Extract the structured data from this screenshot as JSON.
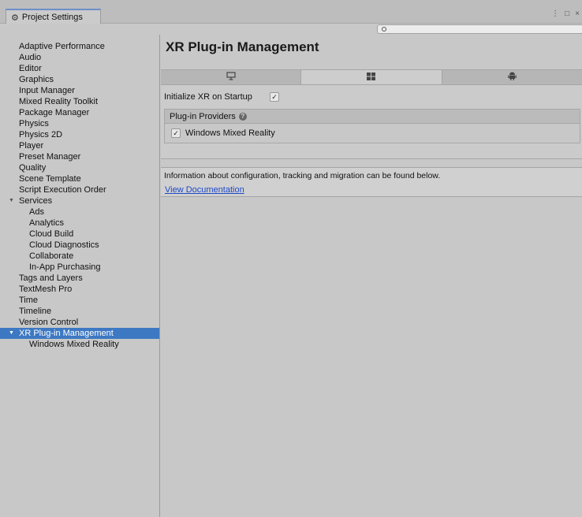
{
  "window": {
    "tab_icon": "gear-icon",
    "tab_icon_glyph": "⚙",
    "tab_title": "Project Settings",
    "controls": [
      "⋮",
      "□",
      "×"
    ]
  },
  "search": {
    "placeholder": "",
    "icon": "search-icon",
    "icon_glyph": "🔍"
  },
  "sidebar": {
    "items": [
      {
        "label": "Adaptive Performance",
        "level": 0
      },
      {
        "label": "Audio",
        "level": 0
      },
      {
        "label": "Editor",
        "level": 0
      },
      {
        "label": "Graphics",
        "level": 0
      },
      {
        "label": "Input Manager",
        "level": 0
      },
      {
        "label": "Mixed Reality Toolkit",
        "level": 0
      },
      {
        "label": "Package Manager",
        "level": 0
      },
      {
        "label": "Physics",
        "level": 0
      },
      {
        "label": "Physics 2D",
        "level": 0
      },
      {
        "label": "Player",
        "level": 0
      },
      {
        "label": "Preset Manager",
        "level": 0
      },
      {
        "label": "Quality",
        "level": 0
      },
      {
        "label": "Scene Template",
        "level": 0
      },
      {
        "label": "Script Execution Order",
        "level": 0
      },
      {
        "label": "Services",
        "level": 0,
        "foldout": "expanded"
      },
      {
        "label": "Ads",
        "level": 1
      },
      {
        "label": "Analytics",
        "level": 1
      },
      {
        "label": "Cloud Build",
        "level": 1
      },
      {
        "label": "Cloud Diagnostics",
        "level": 1
      },
      {
        "label": "Collaborate",
        "level": 1
      },
      {
        "label": "In-App Purchasing",
        "level": 1
      },
      {
        "label": "Tags and Layers",
        "level": 0
      },
      {
        "label": "TextMesh Pro",
        "level": 0
      },
      {
        "label": "Time",
        "level": 0
      },
      {
        "label": "Timeline",
        "level": 0
      },
      {
        "label": "Version Control",
        "level": 0
      },
      {
        "label": "XR Plug-in Management",
        "level": 0,
        "foldout": "expanded",
        "selected": true
      },
      {
        "label": "Windows Mixed Reality",
        "level": 1
      }
    ],
    "selected_color": "#3d78c2"
  },
  "main": {
    "title": "XR Plug-in Management",
    "platform_tabs": [
      {
        "icon": "desktop-icon",
        "glyph": "🖵",
        "active": false
      },
      {
        "icon": "windows-icon",
        "glyph": "⊞",
        "active": true
      },
      {
        "icon": "android-icon",
        "glyph": "⬟",
        "active": false
      }
    ],
    "init_label": "Initialize XR on Startup",
    "init_checked": true,
    "check_glyph": "✓",
    "providers_header": "Plug-in Providers",
    "help_icon": "help-icon",
    "help_glyph": "?",
    "providers": [
      {
        "label": "Windows Mixed Reality",
        "checked": true
      }
    ],
    "info_text": "Information about configuration, tracking and migration can be found below.",
    "doc_link": "View Documentation",
    "link_color": "#1e49c9"
  }
}
